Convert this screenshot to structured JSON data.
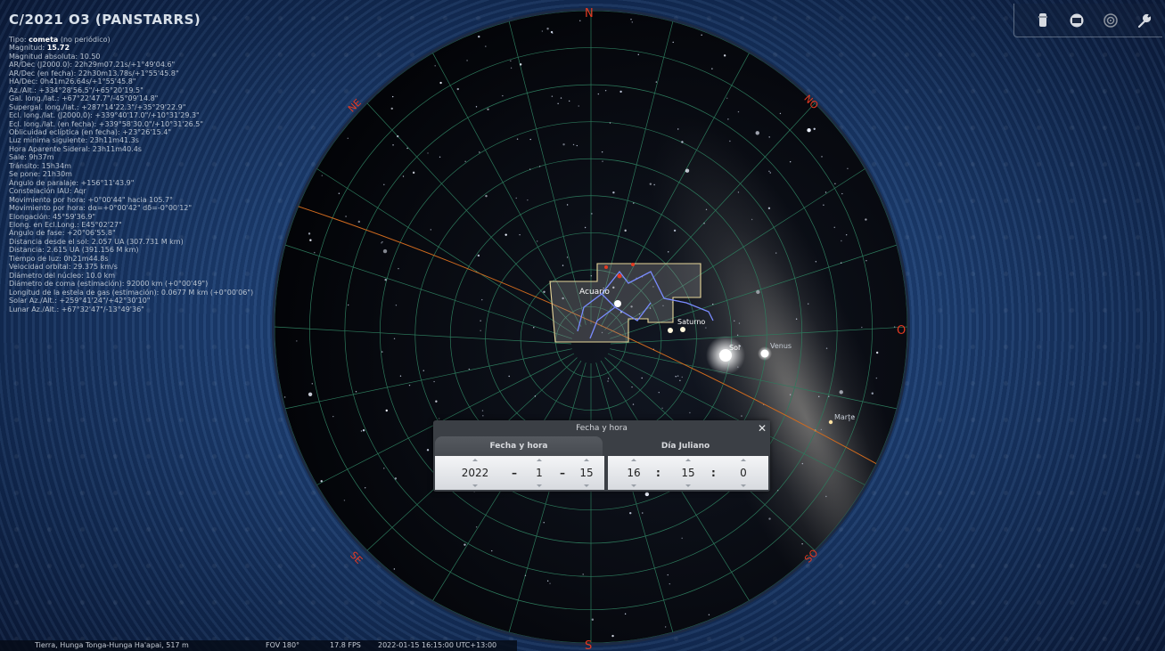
{
  "object": {
    "title": "C/2021 O3 (PANSTARRS)",
    "info_lines": [
      {
        "label": "Tipo: ",
        "value": "cometa",
        "suffix": " (no periódico)"
      },
      {
        "label": "Magnitud: ",
        "value": "15.72",
        "suffix": ""
      },
      {
        "label": "Magnitud absoluta: 10.50",
        "value": "",
        "suffix": ""
      },
      {
        "label": "AR/Dec (J2000.0): 22h29m07.21s/+1°49'04.6\"",
        "value": "",
        "suffix": ""
      },
      {
        "label": "AR/Dec (en fecha): 22h30m13.78s/+1°55'45.8\"",
        "value": "",
        "suffix": ""
      },
      {
        "label": "HA/Dec: 0h41m26.64s/+1°55'45.8\"",
        "value": "",
        "suffix": ""
      },
      {
        "label": "Az./Alt.: +334°28'56.5\"/+65°20'19.5\"",
        "value": "",
        "suffix": ""
      },
      {
        "label": "Gal. long./lat.: +67°22'47.7\"/-45°09'14.8\"",
        "value": "",
        "suffix": ""
      },
      {
        "label": "Supergal. long./lat.: +287°14'22.3\"/+35°29'22.9\"",
        "value": "",
        "suffix": ""
      },
      {
        "label": "Ecl. long./lat. (J2000.0): +339°40'17.0\"/+10°31'29.3\"",
        "value": "",
        "suffix": ""
      },
      {
        "label": "Ecl. long./lat. (en fecha): +339°58'30.0\"/+10°31'26.5\"",
        "value": "",
        "suffix": ""
      },
      {
        "label": "Oblicuidad eclíptica (en fecha): +23°26'15.4\"",
        "value": "",
        "suffix": ""
      },
      {
        "label": "Luz mínima siguiente: 23h11m41.3s",
        "value": "",
        "suffix": ""
      },
      {
        "label": "Hora Aparente Sideral: 23h11m40.4s",
        "value": "",
        "suffix": ""
      },
      {
        "label": "Sale: 9h37m",
        "value": "",
        "suffix": ""
      },
      {
        "label": "Tránsito: 15h34m",
        "value": "",
        "suffix": ""
      },
      {
        "label": "Se pone: 21h30m",
        "value": "",
        "suffix": ""
      },
      {
        "label": "Ángulo de paralaje: +156°11'43.9\"",
        "value": "",
        "suffix": ""
      },
      {
        "label": "Constelación IAU: Aqr",
        "value": "",
        "suffix": ""
      },
      {
        "label": "Movimiento por hora: +0°00'44\" hacia 105.7°",
        "value": "",
        "suffix": ""
      },
      {
        "label": "Movimiento por hora: dα=+0°00'42\" dδ=-0°00'12\"",
        "value": "",
        "suffix": ""
      },
      {
        "label": "Elongación: 45°59'36.9\"",
        "value": "",
        "suffix": ""
      },
      {
        "label": "Elong. en Ecl.Long.: E45°02'27\"",
        "value": "",
        "suffix": ""
      },
      {
        "label": "Ángulo de fase: +20°06'55.8\"",
        "value": "",
        "suffix": ""
      },
      {
        "label": "Distancia desde el sol: 2.057 UA (307.731 M km)",
        "value": "",
        "suffix": ""
      },
      {
        "label": "Distancia: 2.615 UA (391.156 M km)",
        "value": "",
        "suffix": ""
      },
      {
        "label": "Tiempo de luz: 0h21m44.8s",
        "value": "",
        "suffix": ""
      },
      {
        "label": "Velocidad orbital: 29.375 km/s",
        "value": "",
        "suffix": ""
      },
      {
        "label": "Diámetro del núcleo: 10.0 km",
        "value": "",
        "suffix": ""
      },
      {
        "label": "Diámetro de coma (estimación): 92000 km (+0°00'49\")",
        "value": "",
        "suffix": ""
      },
      {
        "label": "Longitud de la estela de gas (estimación): 0.0677 M km (+0°00'06\")",
        "value": "",
        "suffix": ""
      },
      {
        "label": "Solar Az./Alt.: +259°41'24\"/+42°30'10\"",
        "value": "",
        "suffix": ""
      },
      {
        "label": "Lunar Az./Alt.: +67°32'47\"/-13°49'36\"",
        "value": "",
        "suffix": ""
      }
    ]
  },
  "compass": {
    "north": "N",
    "south": "S",
    "west": "O",
    "northeast": "NE",
    "northwest": "NO",
    "southwest": "SO",
    "southeast": "SE"
  },
  "sky_labels": {
    "constellation": "Acuario",
    "saturno": "Saturno",
    "sol": "Sol",
    "venus": "Venus",
    "marte": "Marte"
  },
  "toolbar": {
    "icons": [
      "lamp-icon",
      "screen-icon",
      "target-icon",
      "wrench-icon"
    ]
  },
  "status": {
    "location": "Tierra, Hunga Tonga-Hunga Ha'apai, 517 m",
    "fov": "FOV 180°",
    "fps": "17.8 FPS",
    "datetime": "2022-01-15 16:15:00 UTC+13:00"
  },
  "dialog": {
    "title": "Fecha y hora",
    "close": "✕",
    "tabs": [
      "Fecha y hora",
      "Día Juliano"
    ],
    "date": {
      "year": "2022",
      "month": "1",
      "day": "15",
      "sep": "–"
    },
    "time": {
      "hour": "16",
      "minute": "15",
      "second": "0",
      "sep": ":"
    }
  },
  "colors": {
    "accent_red": "#e43a22",
    "ecliptic": "#d06a1e",
    "grid": "#2d7a5c",
    "constellation_line": "#7a8cff",
    "boundary": "#e8d79a"
  }
}
